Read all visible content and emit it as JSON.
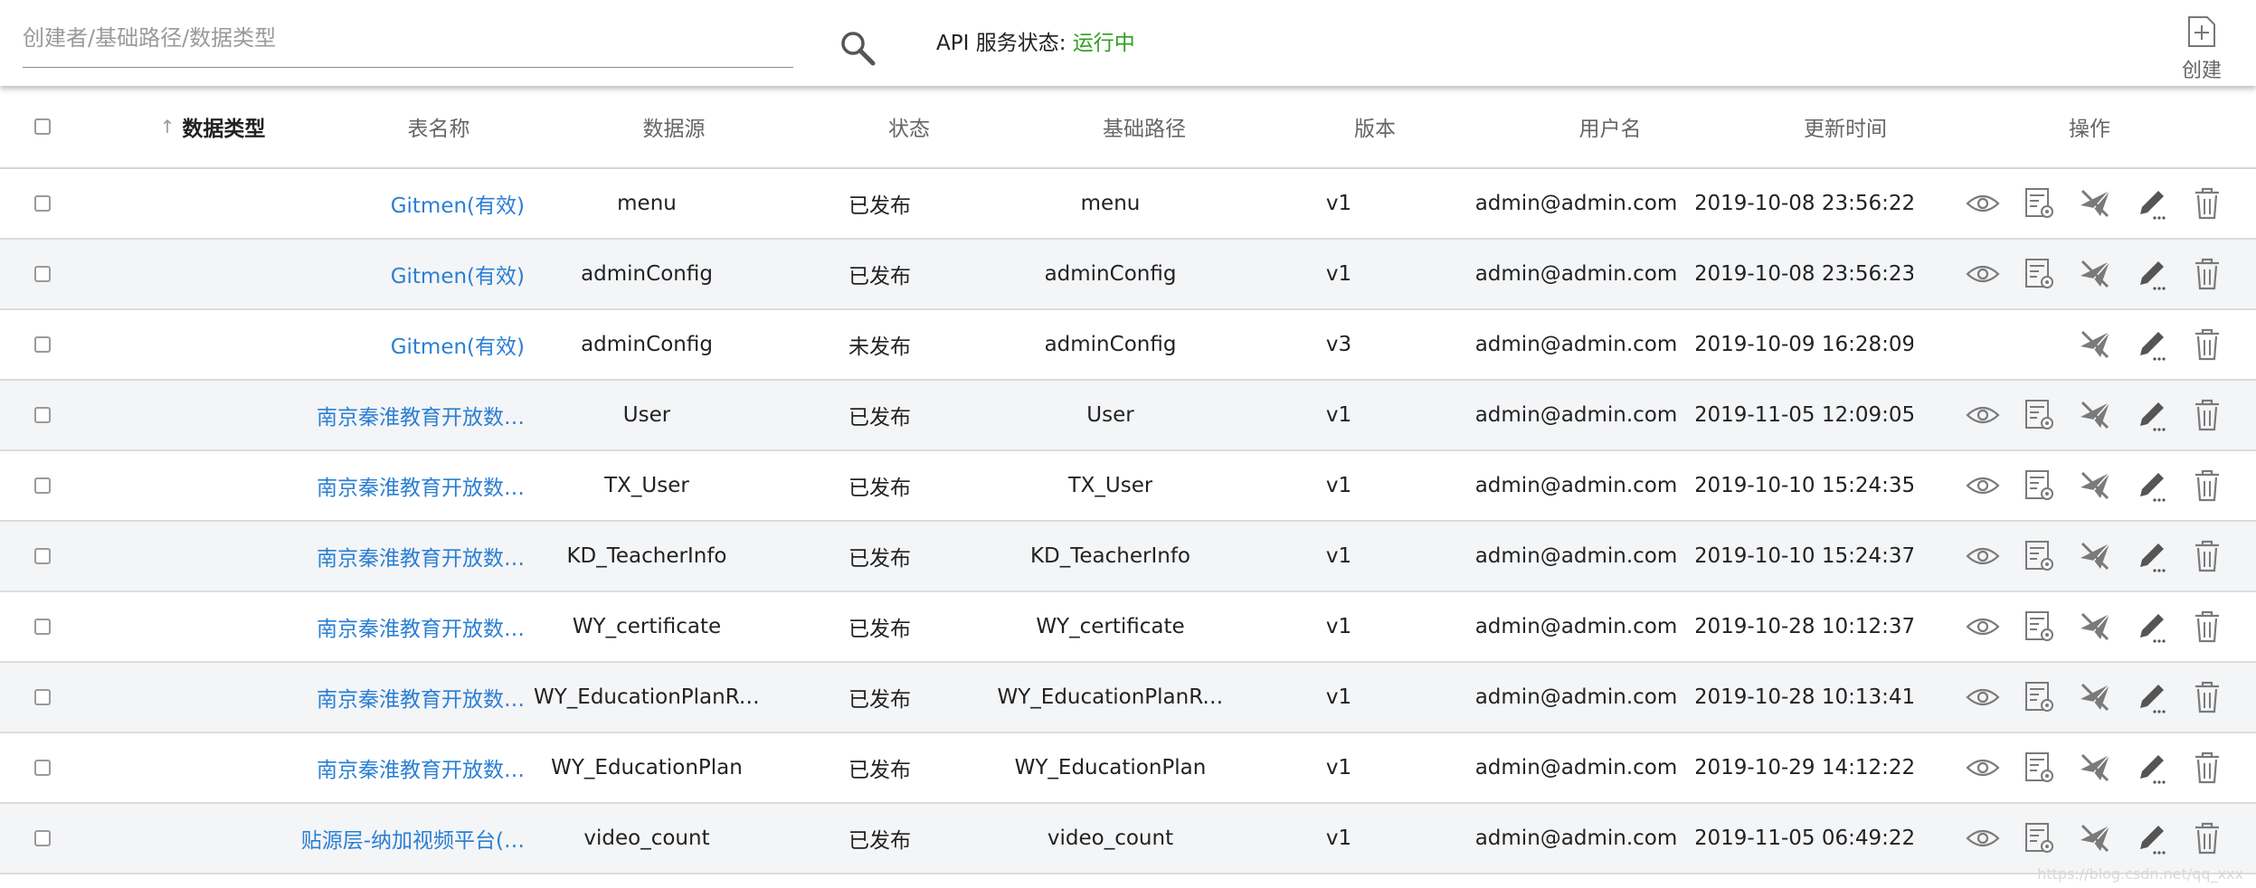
{
  "search": {
    "placeholder": "创建者/基础路径/数据类型",
    "value": ""
  },
  "api_status": {
    "label": "API 服务状态: ",
    "value": "运行中",
    "value_color": "#2f9f1f"
  },
  "create": {
    "label": "创建"
  },
  "table": {
    "columns": {
      "type": "数据类型",
      "table": "表名称",
      "source": "数据源",
      "status": "状态",
      "path": "基础路径",
      "version": "版本",
      "user": "用户名",
      "time": "更新时间",
      "ops": "操作"
    },
    "sort_arrow": "↑",
    "rows": [
      {
        "type": "Gitmen(有效)",
        "table": "menu",
        "status": "已发布",
        "path": "menu",
        "version": "v1",
        "user": "admin@admin.com",
        "time": "2019-10-08 23:56:22",
        "ops": [
          "view",
          "config",
          "publish",
          "edit",
          "delete"
        ]
      },
      {
        "type": "Gitmen(有效)",
        "table": "adminConfig",
        "status": "已发布",
        "path": "adminConfig",
        "version": "v1",
        "user": "admin@admin.com",
        "time": "2019-10-08 23:56:23",
        "ops": [
          "view",
          "config",
          "publish",
          "edit",
          "delete"
        ]
      },
      {
        "type": "Gitmen(有效)",
        "table": "adminConfig",
        "status": "未发布",
        "path": "adminConfig",
        "version": "v3",
        "user": "admin@admin.com",
        "time": "2019-10-09 16:28:09",
        "ops": [
          "publish",
          "edit",
          "delete"
        ]
      },
      {
        "type": "南京秦淮教育开放数…",
        "table": "User",
        "status": "已发布",
        "path": "User",
        "version": "v1",
        "user": "admin@admin.com",
        "time": "2019-11-05 12:09:05",
        "ops": [
          "view",
          "config",
          "publish",
          "edit",
          "delete"
        ]
      },
      {
        "type": "南京秦淮教育开放数…",
        "table": "TX_User",
        "status": "已发布",
        "path": "TX_User",
        "version": "v1",
        "user": "admin@admin.com",
        "time": "2019-10-10 15:24:35",
        "ops": [
          "view",
          "config",
          "publish",
          "edit",
          "delete"
        ]
      },
      {
        "type": "南京秦淮教育开放数…",
        "table": "KD_TeacherInfo",
        "status": "已发布",
        "path": "KD_TeacherInfo",
        "version": "v1",
        "user": "admin@admin.com",
        "time": "2019-10-10 15:24:37",
        "ops": [
          "view",
          "config",
          "publish",
          "edit",
          "delete"
        ]
      },
      {
        "type": "南京秦淮教育开放数…",
        "table": "WY_certificate",
        "status": "已发布",
        "path": "WY_certificate",
        "version": "v1",
        "user": "admin@admin.com",
        "time": "2019-10-28 10:12:37",
        "ops": [
          "view",
          "config",
          "publish",
          "edit",
          "delete"
        ]
      },
      {
        "type": "南京秦淮教育开放数…",
        "table": "WY_EducationPlanRe…",
        "status": "已发布",
        "path": "WY_EducationPlanRe…",
        "version": "v1",
        "user": "admin@admin.com",
        "time": "2019-10-28 10:13:41",
        "ops": [
          "view",
          "config",
          "publish",
          "edit",
          "delete"
        ]
      },
      {
        "type": "南京秦淮教育开放数…",
        "table": "WY_EducationPlan",
        "status": "已发布",
        "path": "WY_EducationPlan",
        "version": "v1",
        "user": "admin@admin.com",
        "time": "2019-10-29 14:12:22",
        "ops": [
          "view",
          "config",
          "publish",
          "edit",
          "delete"
        ]
      },
      {
        "type": "贴源层-纳加视频平台(…",
        "table": "video_count",
        "status": "已发布",
        "path": "video_count",
        "version": "v1",
        "user": "admin@admin.com",
        "time": "2019-11-05 06:49:22",
        "ops": [
          "view",
          "config",
          "publish",
          "edit",
          "delete"
        ]
      }
    ]
  },
  "watermark": "https://blog.csdn.net/qq_xxx"
}
